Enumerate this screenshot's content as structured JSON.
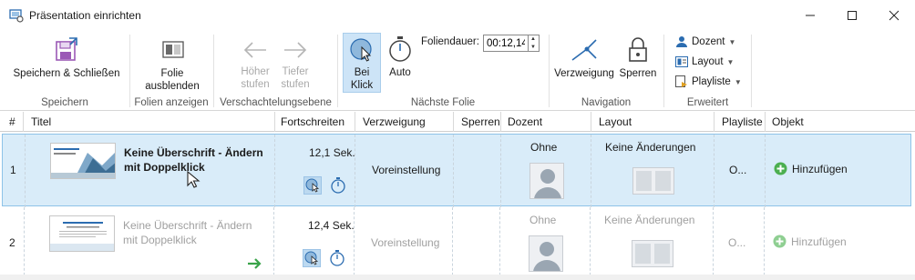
{
  "window": {
    "title": "Präsentation einrichten",
    "controls": [
      "minimize",
      "maximize",
      "close"
    ]
  },
  "ribbon": {
    "groups": {
      "speichern": {
        "label": "Speichern",
        "save_close": "Speichern & Schließen"
      },
      "folien": {
        "label": "Folien anzeigen",
        "hide_line1": "Folie",
        "hide_line2": "ausblenden"
      },
      "verschachtelung": {
        "label": "Verschachtelungsebene",
        "higher_line1": "Höher",
        "higher_line2": "stufen",
        "lower_line1": "Tiefer",
        "lower_line2": "stufen"
      },
      "naechste": {
        "label": "Nächste Folie",
        "bei_klick_line1": "Bei",
        "bei_klick_line2": "Klick",
        "auto": "Auto",
        "duration_label": "Foliendauer:",
        "duration_value": "00:12,14"
      },
      "navigation": {
        "label": "Navigation",
        "verzweigung": "Verzweigung",
        "sperren": "Sperren"
      },
      "erweitert": {
        "label": "Erweitert",
        "dozent": "Dozent",
        "layout": "Layout",
        "playliste": "Playliste"
      }
    }
  },
  "table": {
    "columns": [
      "#",
      "Titel",
      "Fortschreiten",
      "Verzweigung",
      "Sperren",
      "Dozent",
      "Layout",
      "Playliste",
      "Objekt"
    ],
    "rows": [
      {
        "num": "1",
        "title": "Keine Überschrift - Ändern mit Doppelklick",
        "fortschreiten": "12,1 Sek.",
        "verzweigung": "Voreinstellung",
        "dozent": "Ohne",
        "layout": "Keine Änderungen",
        "playliste": "O...",
        "objekt": "Hinzufügen",
        "selected": true
      },
      {
        "num": "2",
        "title": "Keine Überschrift - Ändern mit Doppelklick",
        "fortschreiten": "12,4 Sek.",
        "verzweigung": "Voreinstellung",
        "dozent": "Ohne",
        "layout": "Keine Änderungen",
        "playliste": "O...",
        "objekt": "Hinzufügen",
        "selected": false
      }
    ]
  },
  "colors": {
    "accent": "#2b6cb0",
    "selection": "#d9ecf9",
    "add_green": "#4caf50"
  }
}
